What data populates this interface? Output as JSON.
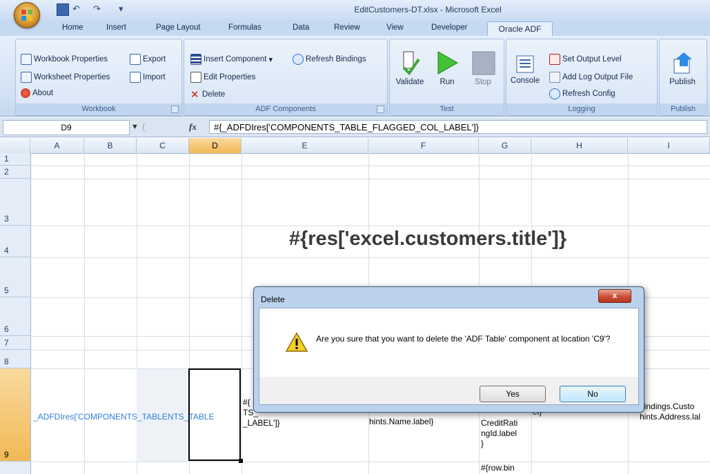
{
  "window": {
    "title": "EditCustomers-DT.xlsx - Microsoft Excel"
  },
  "qat": {
    "undo_glyph": "↶",
    "redo_glyph": "↷",
    "dropdown_glyph": "▾"
  },
  "tabs": [
    "Home",
    "Insert",
    "Page Layout",
    "Formulas",
    "Data",
    "Review",
    "View",
    "Developer",
    "Oracle ADF"
  ],
  "ribbon": {
    "workbook": {
      "label": "Workbook",
      "items": [
        "Workbook Properties",
        "Worksheet Properties",
        "About",
        "Export",
        "Import"
      ]
    },
    "adf_components": {
      "label": "ADF Components",
      "items": [
        "Insert Component",
        "Edit Properties",
        "Delete",
        "Refresh Bindings"
      ],
      "insert_dropdown": "▾"
    },
    "test": {
      "label": "Test",
      "items": [
        "Validate",
        "Run",
        "Stop"
      ]
    },
    "logging": {
      "label": "Logging",
      "console": "Console",
      "items": [
        "Set Output Level",
        "Add Log Output File",
        "Refresh Config"
      ]
    },
    "publish": {
      "label": "Publish",
      "button": "Publish"
    }
  },
  "formula_bar": {
    "name_box": "D9",
    "fx": "fx",
    "formula": "#{_ADFDIres['COMPONENTS_TABLE_FLAGGED_COL_LABEL']}"
  },
  "columns": [
    "A",
    "B",
    "C",
    "D",
    "E",
    "F",
    "G",
    "H",
    "I"
  ],
  "rows": [
    "1",
    "2",
    "3",
    "4",
    "5",
    "6",
    "7",
    "8",
    "9"
  ],
  "cells": {
    "title": "#{res['excel.customers.title']}",
    "row9_blue": "_ADFDIres['COMPONENTS_TABLENTS_TABLE",
    "row9_e": "#{\nTS_\n_LABEL']}",
    "row9_f": "hints.Name.label}",
    "row9_g": "CreditRati\nngId.label\n}",
    "row9_h": "el}",
    "row9_i": "bindings.Custo\nhints.Address.lal",
    "row10_g": "#{row.bin"
  },
  "dialog": {
    "title": "Delete",
    "close": "x",
    "message": "Are you sure that you want to delete the 'ADF Table' component at location 'C9'?",
    "yes": "Yes",
    "no": "No"
  },
  "colors": {
    "accent": "#c5d9f1",
    "selection_header": "#f1b955",
    "title_text": "#3a3a3a",
    "link_blue": "#2f80d8"
  }
}
